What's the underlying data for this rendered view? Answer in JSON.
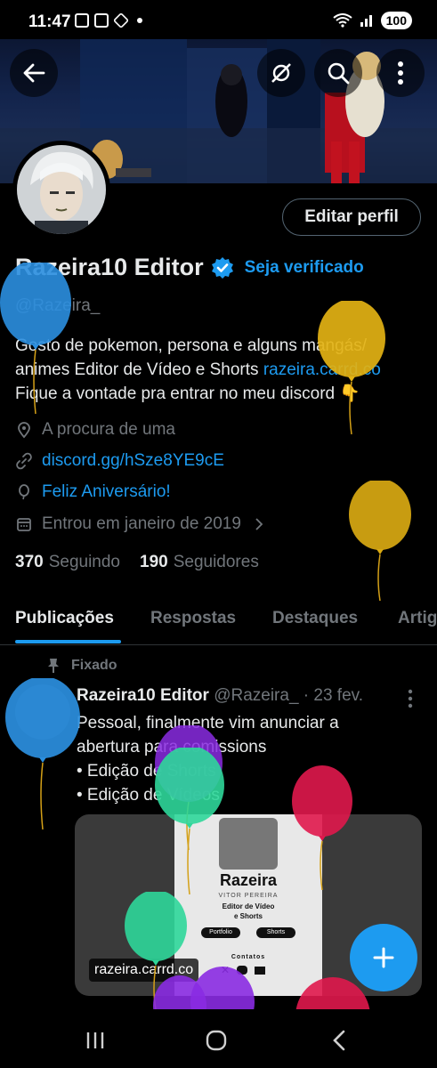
{
  "status_bar": {
    "time": "11:47",
    "battery": "100"
  },
  "profile": {
    "name": "Razeira10 Editor",
    "verify_label": "Seja verificado",
    "handle": "@Razeira_",
    "edit_button": "Editar perfil",
    "bio_line1": "Gosto de pokemon, persona e alguns mangás/",
    "bio_line2": "animes  Editor de Vídeo e Shorts ",
    "bio_link": "razeira.carrd.co",
    "bio_line3": "Fique a vontade pra entrar no meu discord 👇",
    "location": "A procura de uma",
    "website": "discord.gg/hSze8YE9cE",
    "birthday": "Feliz Aniversário!",
    "joined": "Entrou em janeiro de 2019",
    "following_count": "370",
    "following_label": "Seguindo",
    "followers_count": "190",
    "followers_label": "Seguidores"
  },
  "tabs": [
    "Publicações",
    "Respostas",
    "Destaques",
    "Artigos"
  ],
  "post": {
    "pinned_label": "Fixado",
    "author": "Razeira10 Editor",
    "handle_date": "@Razeira_ · 23 fev.",
    "text_line1": "Pessoal, finalmente vim anunciar a",
    "text_line2": "abertura para comissions",
    "text_line3": "• Edição de Shorts",
    "text_line4": "• Edição de Vídeos",
    "card": {
      "title": "Razeira",
      "subtitle": "VITOR PEREIRA",
      "role1": "Editor de Vídeo",
      "role2": "e Shorts",
      "btn1": "Portfolio",
      "btn2": "Shorts",
      "contacts": "Contatos",
      "link_label": "razeira.carrd.co"
    }
  },
  "colors": {
    "accent": "#1d9bf0",
    "text": "#e7e9ea",
    "muted": "#71767b",
    "background": "#000000"
  }
}
